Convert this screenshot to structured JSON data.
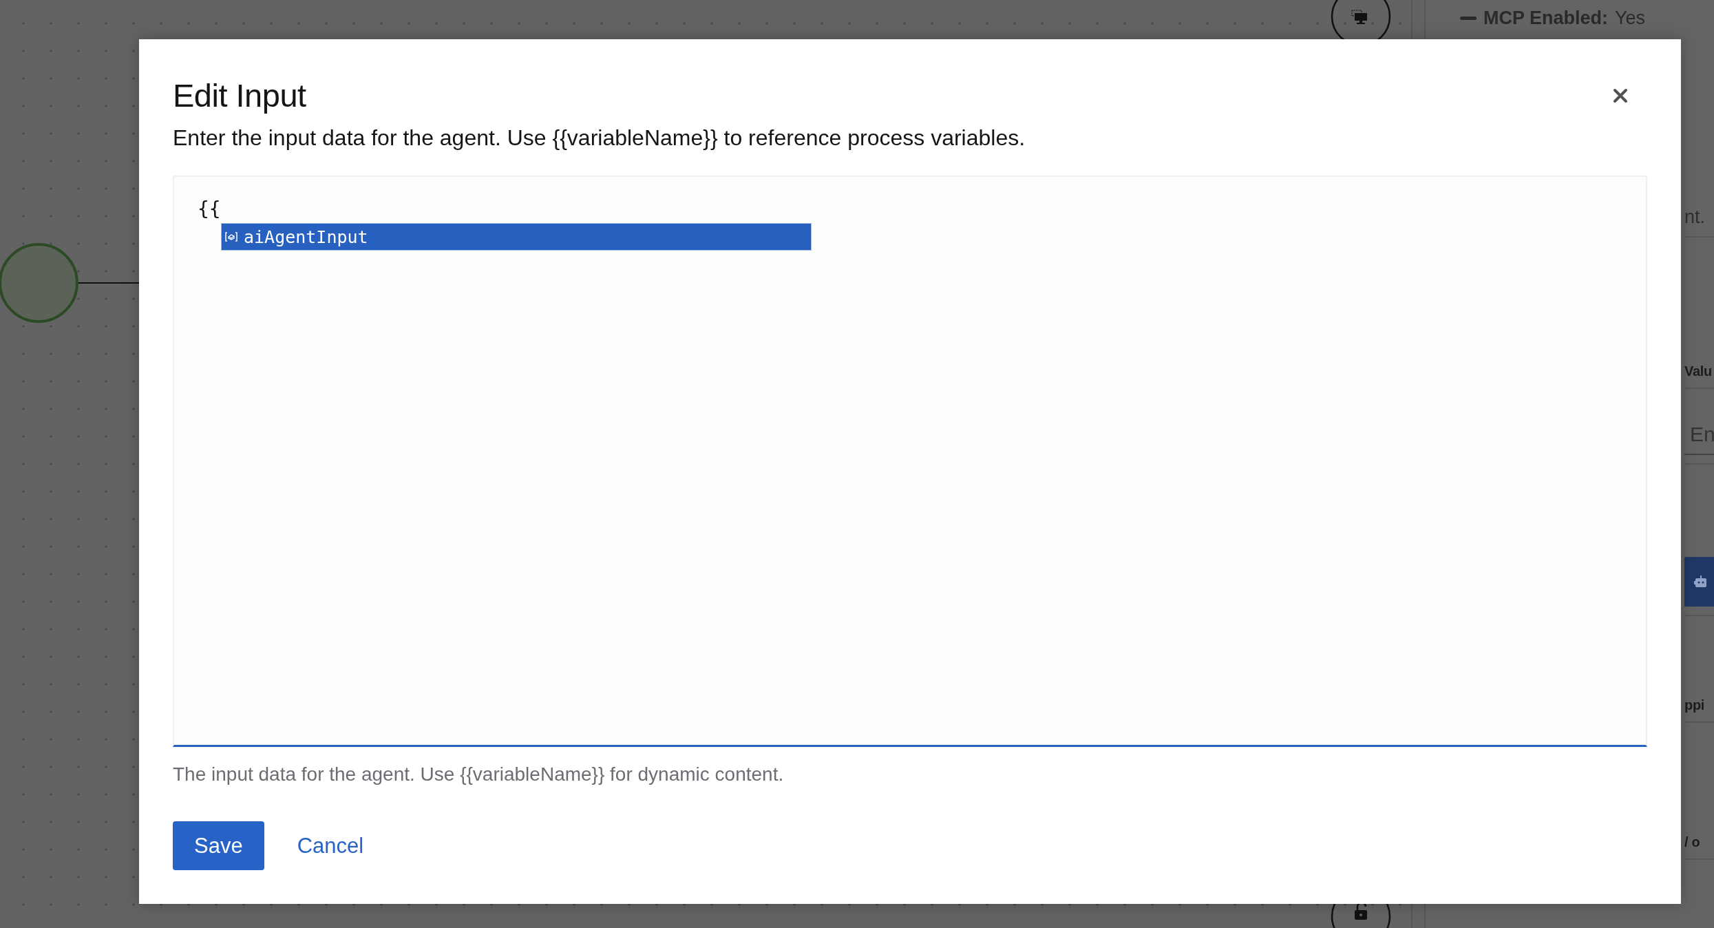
{
  "background": {
    "panel": {
      "mcp_status": {
        "label": "MCP Enabled:",
        "value": "Yes"
      },
      "strip": [
        {
          "kind": "text",
          "text": "nt."
        },
        {
          "kind": "heading",
          "text": "Valu"
        },
        {
          "kind": "field",
          "placeholder": "En"
        },
        {
          "kind": "robot-button"
        },
        {
          "kind": "heading",
          "text": "ppi"
        },
        {
          "kind": "heading",
          "text": "/ o"
        }
      ]
    }
  },
  "modal": {
    "title": "Edit Input",
    "description": "Enter the input data for the agent. Use {{variableName}} to reference process variables.",
    "editor": {
      "value": "{{",
      "suggestions": [
        {
          "label": "aiAgentInput",
          "selected": true
        }
      ]
    },
    "helper_text": "The input data for the agent. Use {{variableName}} for dynamic content.",
    "buttons": [
      {
        "label": "Save",
        "kind": "primary"
      },
      {
        "label": "Cancel",
        "kind": "link"
      }
    ]
  }
}
